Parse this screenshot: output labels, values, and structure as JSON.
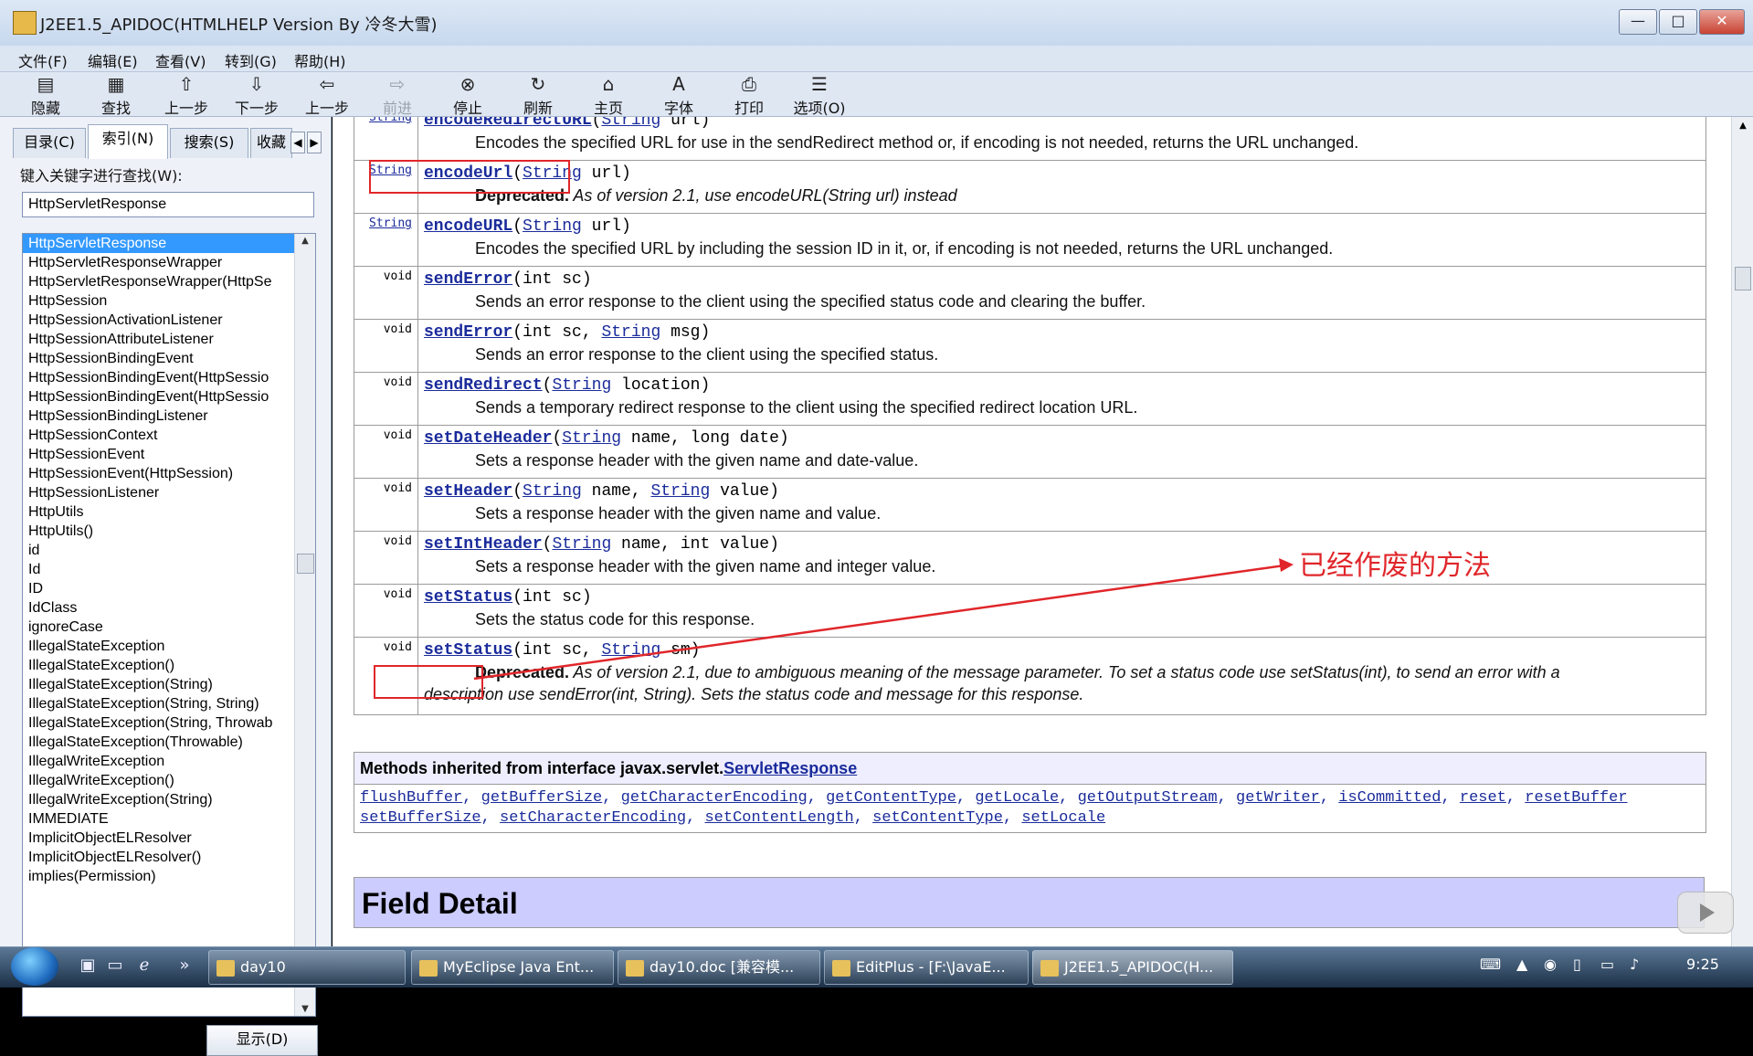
{
  "window": {
    "title": "J2EE1.5_APIDOC(HTMLHELP Version By 冷冬大雪)",
    "minimize": "—",
    "maximize": "□",
    "close": "✕"
  },
  "menu": [
    "文件(F)",
    "编辑(E)",
    "查看(V)",
    "转到(G)",
    "帮助(H)"
  ],
  "toolbar": [
    {
      "label": "隐藏",
      "icon": "hide-icon",
      "glyph": "▤",
      "enabled": true
    },
    {
      "label": "查找",
      "icon": "find-icon",
      "glyph": "▦",
      "enabled": true
    },
    {
      "label": "上一步",
      "icon": "up-arrow-icon",
      "glyph": "⇧",
      "enabled": true
    },
    {
      "label": "下一步",
      "icon": "down-arrow-icon",
      "glyph": "⇩",
      "enabled": true
    },
    {
      "label": "上一步",
      "icon": "back-arrow-icon",
      "glyph": "⇦",
      "enabled": true
    },
    {
      "label": "前进",
      "icon": "forward-arrow-icon",
      "glyph": "⇨",
      "enabled": false
    },
    {
      "label": "停止",
      "icon": "stop-icon",
      "glyph": "⊗",
      "enabled": true
    },
    {
      "label": "刷新",
      "icon": "refresh-icon",
      "glyph": "↻",
      "enabled": true
    },
    {
      "label": "主页",
      "icon": "home-icon",
      "glyph": "⌂",
      "enabled": true
    },
    {
      "label": "字体",
      "icon": "font-icon",
      "glyph": "A",
      "enabled": true
    },
    {
      "label": "打印",
      "icon": "print-icon",
      "glyph": "⎙",
      "enabled": true
    },
    {
      "label": "选项(O)",
      "icon": "options-icon",
      "glyph": "☰",
      "enabled": true
    }
  ],
  "tabs": [
    {
      "label": "目录(C)",
      "active": false
    },
    {
      "label": "索引(N)",
      "active": true
    },
    {
      "label": "搜索(S)",
      "active": false
    },
    {
      "label": "收藏",
      "active": false
    }
  ],
  "index": {
    "keyword_label": "键入关键字进行查找(W):",
    "keyword_value": "HttpServletResponse",
    "items": [
      "HttpServletResponse",
      "HttpServletResponseWrapper",
      "HttpServletResponseWrapper(HttpSe",
      "HttpSession",
      "HttpSessionActivationListener",
      "HttpSessionAttributeListener",
      "HttpSessionBindingEvent",
      "HttpSessionBindingEvent(HttpSessio",
      "HttpSessionBindingEvent(HttpSessio",
      "HttpSessionBindingListener",
      "HttpSessionContext",
      "HttpSessionEvent",
      "HttpSessionEvent(HttpSession)",
      "HttpSessionListener",
      "HttpUtils",
      "HttpUtils()",
      "id",
      "Id",
      "ID",
      "IdClass",
      "ignoreCase",
      "IllegalStateException",
      "IllegalStateException()",
      "IllegalStateException(String)",
      "IllegalStateException(String, String)",
      "IllegalStateException(String, Throwab",
      "IllegalStateException(Throwable)",
      "IllegalWriteException",
      "IllegalWriteException()",
      "IllegalWriteException(String)",
      "IMMEDIATE",
      "ImplicitObjectELResolver",
      "ImplicitObjectELResolver()",
      "implies(Permission)"
    ],
    "selected_index": 0,
    "show_button": "显示(D)"
  },
  "methods": [
    {
      "ret": "String",
      "name": "encodeRedirectURL",
      "params": [
        {
          "t": "String",
          "link": true
        },
        {
          "t": " url)",
          "link": false
        }
      ],
      "desc": "Encodes the specified URL for use in the sendRedirect method or, if encoding is not needed, returns the URL unchanged.",
      "deprecated": false
    },
    {
      "ret": "String",
      "name": "encodeUrl",
      "params": [
        {
          "t": "String",
          "link": true
        },
        {
          "t": " url)",
          "link": false
        }
      ],
      "dep_label": "Deprecated.",
      "desc": "As of version 2.1, use encodeURL(String url) instead",
      "deprecated": true
    },
    {
      "ret": "String",
      "name": "encodeURL",
      "params": [
        {
          "t": "String",
          "link": true
        },
        {
          "t": " url)",
          "link": false
        }
      ],
      "desc": "Encodes the specified URL by including the session ID in it, or, if encoding is not needed, returns the URL unchanged.",
      "deprecated": false
    },
    {
      "ret": "void",
      "name": "sendError",
      "params": [
        {
          "t": "int sc)",
          "link": false
        }
      ],
      "desc": "Sends an error response to the client using the specified status code and clearing the buffer.",
      "deprecated": false
    },
    {
      "ret": "void",
      "name": "sendError",
      "params": [
        {
          "t": "int sc, ",
          "link": false
        },
        {
          "t": "String",
          "link": true
        },
        {
          "t": " msg)",
          "link": false
        }
      ],
      "desc": "Sends an error response to the client using the specified status.",
      "deprecated": false
    },
    {
      "ret": "void",
      "name": "sendRedirect",
      "params": [
        {
          "t": "String",
          "link": true
        },
        {
          "t": " location)",
          "link": false
        }
      ],
      "desc": "Sends a temporary redirect response to the client using the specified redirect location URL.",
      "deprecated": false
    },
    {
      "ret": "void",
      "name": "setDateHeader",
      "params": [
        {
          "t": "String",
          "link": true
        },
        {
          "t": " name, long date)",
          "link": false
        }
      ],
      "desc": "Sets a response header with the given name and date-value.",
      "deprecated": false
    },
    {
      "ret": "void",
      "name": "setHeader",
      "params": [
        {
          "t": "String",
          "link": true
        },
        {
          "t": " name, ",
          "link": false
        },
        {
          "t": "String",
          "link": true
        },
        {
          "t": " value)",
          "link": false
        }
      ],
      "desc": "Sets a response header with the given name and value.",
      "deprecated": false
    },
    {
      "ret": "void",
      "name": "setIntHeader",
      "params": [
        {
          "t": "String",
          "link": true
        },
        {
          "t": " name, int value)",
          "link": false
        }
      ],
      "desc": "Sets a response header with the given name and integer value.",
      "deprecated": false
    },
    {
      "ret": "void",
      "name": "setStatus",
      "params": [
        {
          "t": "int sc)",
          "link": false
        }
      ],
      "desc": "Sets the status code for this response.",
      "deprecated": false
    },
    {
      "ret": "void",
      "name": "setStatus",
      "params": [
        {
          "t": "int sc, ",
          "link": false
        },
        {
          "t": "String",
          "link": true
        },
        {
          "t": " sm)",
          "link": false
        }
      ],
      "dep_label": "Deprecated.",
      "desc": "As of version 2.1, due to ambiguous meaning of the message parameter. To set a status code use setStatus(int), to send an error with a",
      "desc2": "description use sendError(int, String). Sets the status code and message for this response.",
      "deprecated": true
    }
  ],
  "inherited": {
    "header_prefix": "Methods inherited from interface javax.servlet.",
    "header_link": "ServletResponse",
    "line1": [
      "flushBuffer",
      "getBufferSize",
      "getCharacterEncoding",
      "getContentType",
      "getLocale",
      "getOutputStream",
      "getWriter",
      "isCommitted",
      "reset",
      "resetBuffer"
    ],
    "line2": [
      "setBufferSize",
      "setCharacterEncoding",
      "setContentLength",
      "setContentType",
      "setLocale"
    ]
  },
  "field_detail": "Field Detail",
  "annotation": "已经作废的方法",
  "colors": {
    "annotation_red": "#e0262a",
    "link_blue": "#1a2b9b",
    "selection_blue": "#3399ff",
    "field_header_bg": "#ccccff"
  },
  "taskbar": {
    "tasks": [
      {
        "label": "day10",
        "active": false
      },
      {
        "label": "MyEclipse Java Ent...",
        "active": false
      },
      {
        "label": "day10.doc [兼容模...",
        "active": false
      },
      {
        "label": "EditPlus - [F:\\JavaE...",
        "active": false
      },
      {
        "label": "J2EE1.5_APIDOC(H...",
        "active": true
      }
    ],
    "clock": "9:25"
  }
}
